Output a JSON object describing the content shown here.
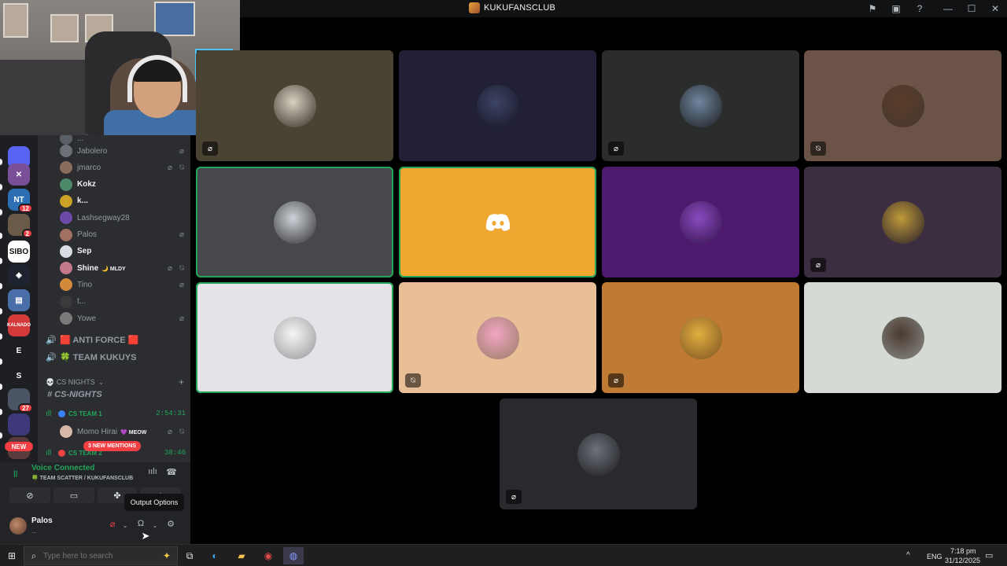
{
  "window": {
    "title": "KUKUFANSCLUB",
    "controls": [
      "⚑",
      "▣",
      "?",
      "—",
      "☐",
      "✕"
    ]
  },
  "servers": [
    {
      "color": "#5865f2",
      "label": "",
      "badge": ""
    },
    {
      "color": "#7a4f9a",
      "label": "✕",
      "badge": ""
    },
    {
      "color": "#2d6fb5",
      "label": "NT",
      "badge": "12"
    },
    {
      "color": "#6b5a48",
      "label": "",
      "badge": "2"
    },
    {
      "color": "#ffffff",
      "label": "SIBO",
      "badge": ""
    },
    {
      "color": "#1d2430",
      "label": "◈",
      "badge": ""
    },
    {
      "color": "#4a6ea8",
      "label": "▤",
      "badge": ""
    },
    {
      "color": "#d43a3a",
      "label": "KALNADO",
      "badge": ""
    },
    {
      "color": "#1e1f22",
      "label": "E",
      "badge": ""
    },
    {
      "color": "#1e1f22",
      "label": "S",
      "badge": ""
    },
    {
      "color": "#4a5566",
      "label": "",
      "badge": "27"
    },
    {
      "color": "#3e3a7a",
      "label": "",
      "badge": ""
    },
    {
      "color": "#5a3a3a",
      "label": "",
      "badge": ""
    }
  ],
  "rail_new": "NEW",
  "members": [
    {
      "name": "Jabolero",
      "online": false,
      "mic_off": true,
      "deaf": false,
      "avatar": "#6d6f78"
    },
    {
      "name": "jmarco",
      "online": false,
      "mic_off": true,
      "deaf": true,
      "avatar": "#8a6d5a"
    },
    {
      "name": "Kokz",
      "online": true,
      "mic_off": false,
      "deaf": false,
      "avatar": "#4e8a6a"
    },
    {
      "name": "k...",
      "online": true,
      "mic_off": false,
      "deaf": false,
      "avatar": "#c9a227"
    },
    {
      "name": "Lashsegway28",
      "online": false,
      "mic_off": false,
      "deaf": false,
      "avatar": "#6e4aa8"
    },
    {
      "name": "Palos",
      "online": false,
      "mic_off": true,
      "deaf": false,
      "avatar": "#a07060"
    },
    {
      "name": "Sep",
      "online": true,
      "mic_off": false,
      "deaf": false,
      "avatar": "#d9dde3"
    },
    {
      "name": "Shine",
      "online": true,
      "mic_off": true,
      "deaf": true,
      "avatar": "#c47a8a",
      "tag": "🌙 MLDY"
    },
    {
      "name": "Tino",
      "online": false,
      "mic_off": true,
      "deaf": false,
      "avatar": "#d08a3a"
    },
    {
      "name": "t...",
      "online": false,
      "mic_off": false,
      "deaf": false,
      "avatar": "#3a3a3a"
    },
    {
      "name": "Yowe",
      "online": false,
      "mic_off": true,
      "deaf": false,
      "avatar": "#7a7a7a"
    }
  ],
  "voice_channels": [
    {
      "name": "🟥 ANTI FORCE 🟥"
    },
    {
      "name": "🍀 TEAM KUKUYS"
    }
  ],
  "category": {
    "name": "💀 CS NIGHTS",
    "chevron": "⌄",
    "plus": "+"
  },
  "text_channel": "# CS-NIGHTS",
  "teams": [
    {
      "name": "CS TEAM 1",
      "dot": "#3b82f6",
      "timer": "2:54:31"
    },
    {
      "name": "CS TEAM 2",
      "dot": "#ef4444",
      "timer": "38:46"
    }
  ],
  "team_member": {
    "name": "Momo Hirai",
    "tag": "💜 MEOW",
    "avatar": "#d7b7a5"
  },
  "mentions_pill": "3 NEW MENTIONS",
  "voice_panel": {
    "status": "Voice Connected",
    "channel": "🍀 TEAM SCATTER / KUKUFANSCLUB",
    "tooltip": "Output Options"
  },
  "user": {
    "name": "Palos",
    "status": "..."
  },
  "tiles": [
    {
      "bg": "#4a4233",
      "avatar": "#d8d0c2",
      "mute": "mic"
    },
    {
      "bg": "#222036",
      "avatar": "#3d4466",
      "mute": ""
    },
    {
      "bg": "#2b2c2c",
      "avatar": "#6f86a0",
      "mute": "mic"
    },
    {
      "bg": "#6b5447",
      "avatar": "#5a3d2a",
      "mute": "deaf"
    },
    {
      "bg": "#46484e",
      "avatar": "#cfd2d8",
      "mute": "",
      "speaking": true
    },
    {
      "bg": "#f0a731",
      "avatar": "",
      "mute": "",
      "speaking": true,
      "discord": true
    },
    {
      "bg": "#4d1a6e",
      "avatar": "#8a4bc0",
      "mute": ""
    },
    {
      "bg": "#3a2e40",
      "avatar": "#c09a3a",
      "mute": "mic"
    },
    {
      "bg": "#e6e3e8",
      "avatar": "#f7f7f7",
      "mute": "",
      "speaking": true
    },
    {
      "bg": "#e8bf96",
      "avatar": "#f2a5c4",
      "mute": "deaf"
    },
    {
      "bg": "#bf7a34",
      "avatar": "#e0b040",
      "mute": "mic"
    },
    {
      "bg": "#d5dad4",
      "avatar": "#4a3a30",
      "mute": ""
    },
    {
      "bg": "#292a2e",
      "avatar": "#6d717a",
      "mute": "mic"
    }
  ],
  "taskbar": {
    "search_placeholder": "Type here to search",
    "lang": "ENG",
    "time": "7:18 pm",
    "date": "31/12/2025"
  }
}
